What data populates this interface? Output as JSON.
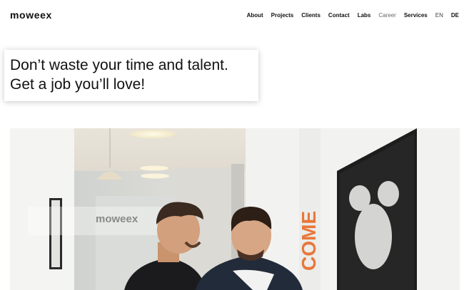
{
  "brand": {
    "logo_text": "moweex"
  },
  "nav": {
    "items": [
      {
        "label": "About",
        "style": "bold"
      },
      {
        "label": "Projects",
        "style": "bold"
      },
      {
        "label": "Clients",
        "style": "bold"
      },
      {
        "label": "Contact",
        "style": "bold"
      },
      {
        "label": "Labs",
        "style": "bold"
      },
      {
        "label": "Career",
        "style": "light"
      },
      {
        "label": "Services",
        "style": "bold"
      }
    ],
    "languages": [
      {
        "label": "EN",
        "active": false
      },
      {
        "label": "DE",
        "active": true
      }
    ]
  },
  "headline": {
    "line1": "Don’t waste your time and talent.",
    "line2": "Get a job you’ll love!"
  },
  "hero": {
    "wall_sign_text": "moweex",
    "vertical_wall_text": "COME",
    "accent_color": "#e8773a"
  }
}
